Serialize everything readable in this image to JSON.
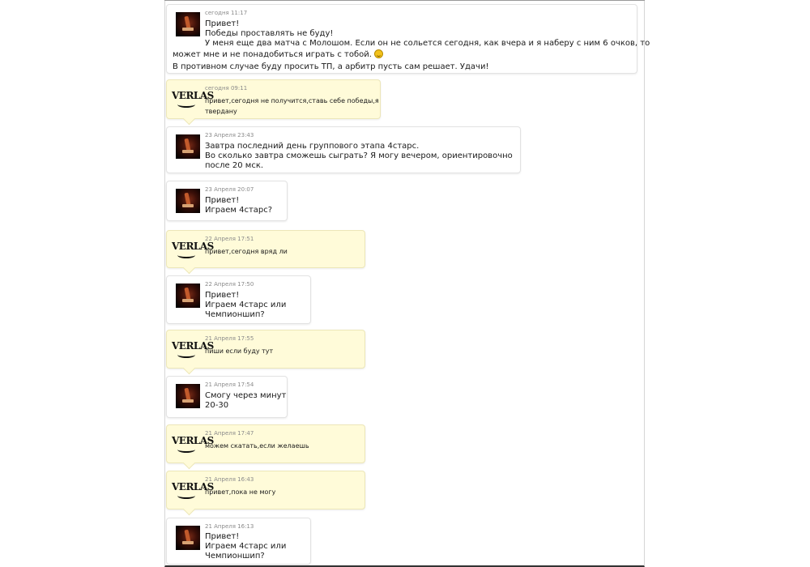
{
  "messages": [
    {
      "sender": "avatar",
      "time": "сегодня 11:17",
      "lines": [
        "Привет!",
        "Победы проставлять не буду!",
        "У меня еще два матча с Молошом. Если он не сольется сегодня, как вчера и я наберу с ним 6 очков, то"
      ],
      "full_lines": [
        "может мне и не понадобиться играть с тобой.",
        "В противном случае буду просить ТП, а арбитр пусть сам решает. Удачи!"
      ],
      "smile_icon": "smiley-icon"
    },
    {
      "sender": "logo",
      "logo_text": "VERLAS",
      "time": "сегодня 09:11",
      "lines": [
        "привет,сегодня не получится,ставь себе победы,я",
        "твердану"
      ]
    },
    {
      "sender": "avatar",
      "time": "23 Апреля 23:43",
      "lines": [
        "Завтра последний день группового этапа 4старс.",
        "Во сколько завтра сможешь сыграть? Я могу вечером, ориентировочно",
        "после 20 мск."
      ]
    },
    {
      "sender": "avatar",
      "time": "23 Апреля 20:07",
      "lines": [
        "Привет!",
        "Играем 4старс?"
      ]
    },
    {
      "sender": "logo",
      "logo_text": "VERLAS",
      "time": "22 Апреля 17:51",
      "lines": [
        "привет,сегодня вряд ли"
      ]
    },
    {
      "sender": "avatar",
      "time": "22 Апреля 17:50",
      "lines": [
        "Привет!",
        "Играем 4старс или",
        "Чемпионшип?"
      ]
    },
    {
      "sender": "logo",
      "logo_text": "VERLAS",
      "time": "21 Апреля 17:55",
      "lines": [
        "пиши если буду тут"
      ]
    },
    {
      "sender": "avatar",
      "time": "21 Апреля 17:54",
      "lines": [
        "Смогу через минут",
        "20-30"
      ]
    },
    {
      "sender": "logo",
      "logo_text": "VERLAS",
      "time": "21 Апреля 17:47",
      "lines": [
        "можем скатать,если желаешь"
      ]
    },
    {
      "sender": "logo",
      "logo_text": "VERLAS",
      "time": "21 Апреля 16:43",
      "lines": [
        "привет,пока не могу"
      ]
    },
    {
      "sender": "avatar",
      "time": "21 Апреля 16:13",
      "lines": [
        "Привет!",
        "Играем 4старс или",
        "Чемпионшип?"
      ]
    }
  ],
  "colors": {
    "theirs_bg": "#fffbd9",
    "mine_bg": "#ffffff"
  }
}
